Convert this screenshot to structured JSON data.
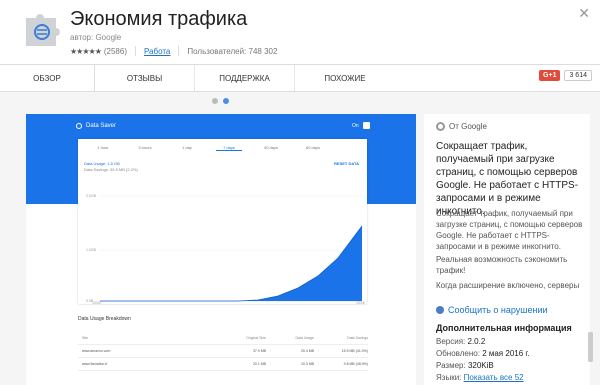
{
  "header": {
    "title": "Экономия трафика",
    "author": "автор: Google",
    "stars": "★★★★★",
    "rating_count": "(2586)",
    "category": "Работа",
    "users": "Пользователей: 748 302"
  },
  "tabs": [
    "ОБЗОР",
    "ОТЗЫВЫ",
    "ПОДДЕРЖКА",
    "ПОХОЖИЕ"
  ],
  "share": {
    "gplus": "G+1",
    "count": "3 614"
  },
  "screenshot": {
    "app_title": "Data Saver",
    "on_label": "On",
    "ranges": [
      "1 hour",
      "3 hours",
      "1 day",
      "7 days",
      "30 days",
      "60 days"
    ],
    "data_usage": "Data Usage: 1.5 GB",
    "data_savings": "Data Savings: 35.5 MB (2.2%)",
    "reset": "RESET DATA",
    "y_labels": [
      "2.0GB",
      "1.0GB",
      "0.0B"
    ],
    "x_labels": [
      "10/20",
      "10/26"
    ],
    "breakdown_title": "Data Usage Breakdown",
    "table_head": [
      "Site",
      "Original Size",
      "Data Usage",
      "Data Savings"
    ],
    "rows": [
      [
        "www.amazon.com",
        "37.9 MB",
        "20.4 MB",
        "15.5 MB (41.0%)"
      ],
      [
        "www.9aviation.fr",
        "20.1 MB",
        "10.3 MB",
        "9.8 MB (48.9%)"
      ]
    ]
  },
  "sidebar": {
    "from_google": "От Google",
    "desc_bold": "Сокращает трафик, получаемый при загрузке страниц, с помощью серверов Google. Не работает с HTTPS-запросами и в режиме инкогнито.",
    "desc": "Сокращает трафик, получаемый при загрузке страниц, с помощью серверов Google. Не работает с HTTPS-запросами и в режиме инкогнито.",
    "desc2": "Реальная возможность сэкономить трафик!",
    "desc3": "Когда расширение включено, серверы",
    "report": "Сообщить о нарушении",
    "additional_title": "Дополнительная информация",
    "version_label": "Версия:",
    "version": "2.0.2",
    "updated_label": "Обновлено:",
    "updated": "2 мая 2016 г.",
    "size_label": "Размер:",
    "size": "320KiB",
    "languages_label": "Языки:",
    "languages_link": "Показать все 52"
  },
  "colors": {
    "accent": "#1a73e8",
    "link": "#1a73c6",
    "gplus": "#e04b3b"
  }
}
